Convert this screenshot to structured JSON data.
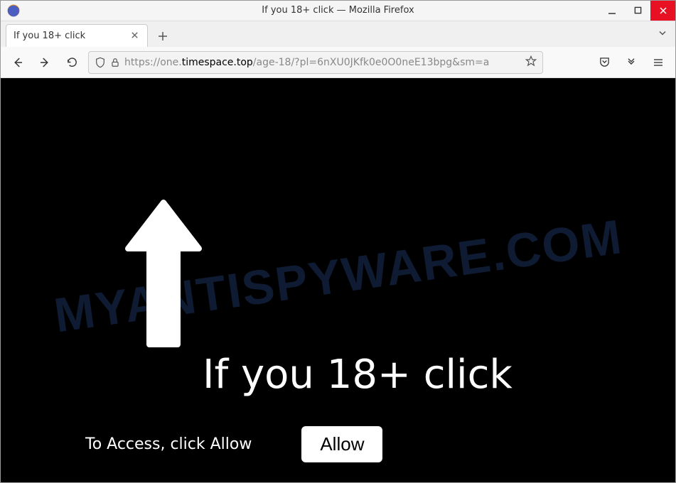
{
  "window": {
    "title": "If you 18+ click — Mozilla Firefox"
  },
  "tabs": {
    "active": {
      "label": "If you 18+ click"
    }
  },
  "url": {
    "protocol": "https://",
    "sub": "one.",
    "domain": "timespace.top",
    "path": "/age-18/?pl=6nXU0JKfk0e0O0neE13bpg&sm=a"
  },
  "page": {
    "headline": "If you 18+ click",
    "subtext": "To Access, click Allow",
    "allow_label": "Allow"
  },
  "watermark": "MYANTISPYWARE.COM"
}
